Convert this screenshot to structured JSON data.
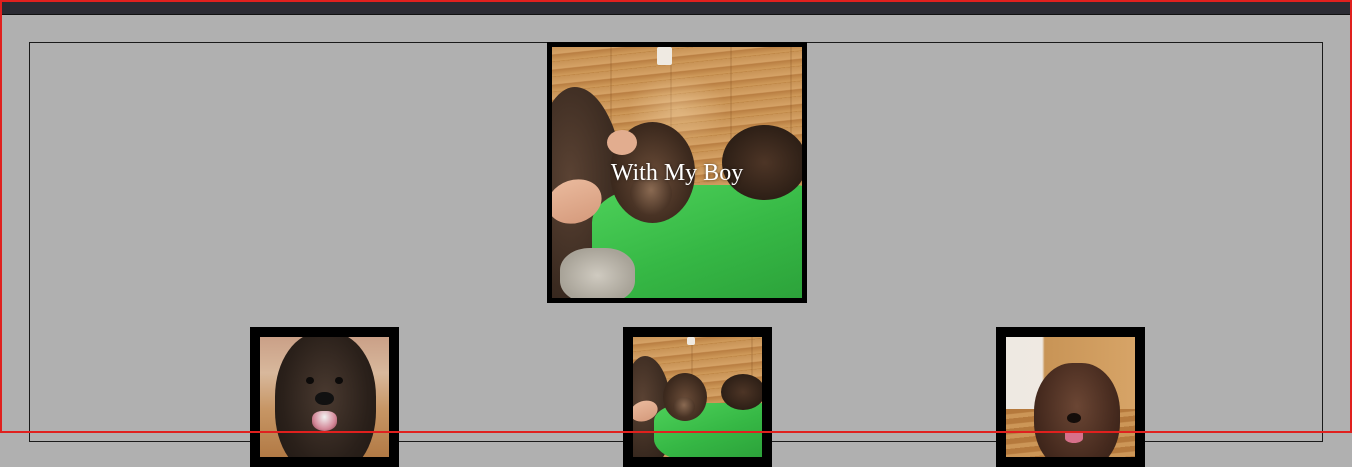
{
  "page": {
    "colors": {
      "background": "#b0b0b0",
      "topbar": "#2b2b33",
      "frame_outline": "#e0201e",
      "photo_border": "#000000",
      "caption_text": "#ffffff"
    }
  },
  "featured": {
    "caption": "With My Boy"
  },
  "thumbnails": [
    {
      "subject": "dog-closeup-photo"
    },
    {
      "subject": "dog-and-boy-photo"
    },
    {
      "subject": "dog-on-floor-photo"
    }
  ]
}
